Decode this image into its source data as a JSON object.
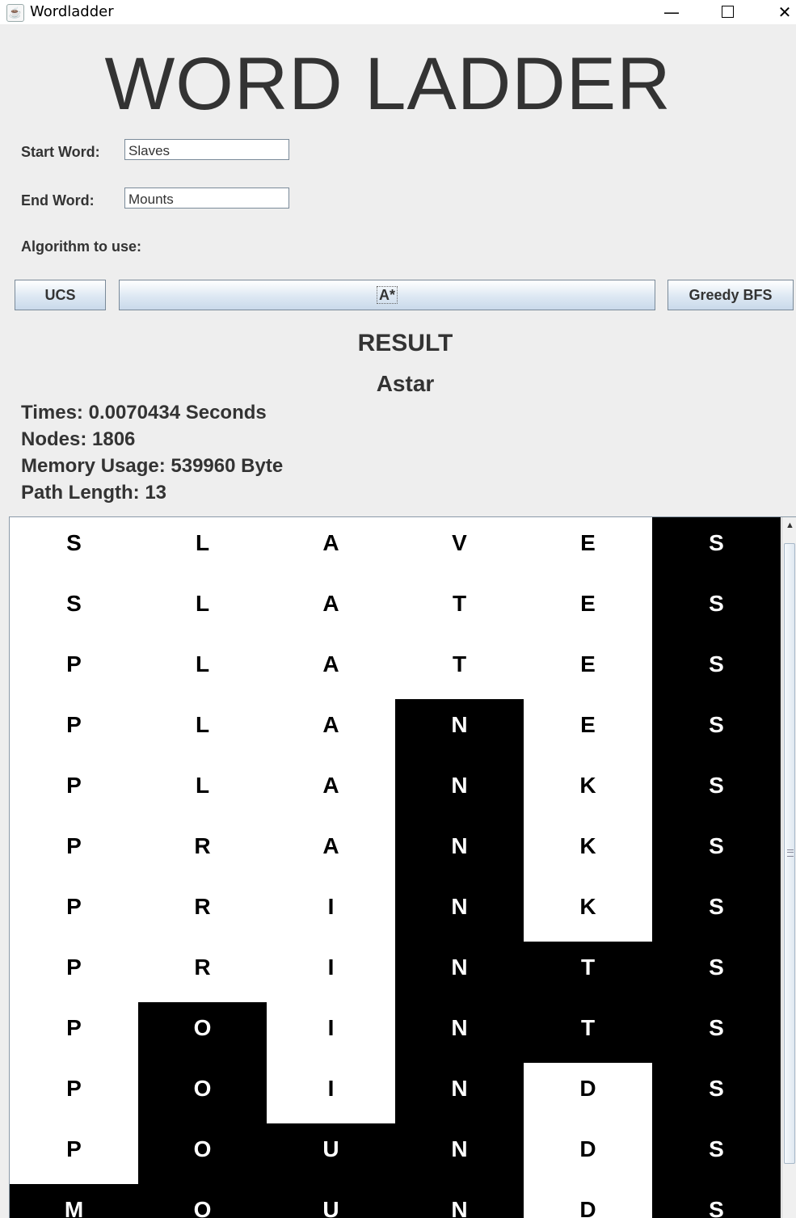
{
  "window": {
    "title": "Wordladder",
    "minimize_glyph": "—",
    "close_glyph": "✕",
    "app_icon": "java-cup-icon"
  },
  "header": {
    "title": "WORD LADDER"
  },
  "form": {
    "start_label": "Start Word:",
    "start_value": "Slaves",
    "end_label": "End Word:",
    "end_value": "Mounts",
    "algorithm_label": "Algorithm to use:"
  },
  "buttons": {
    "ucs": "UCS",
    "astar": "A*",
    "greedy": "Greedy BFS"
  },
  "result": {
    "heading": "RESULT",
    "algorithm": "Astar",
    "times": "Times: 0.0070434 Seconds",
    "nodes": "Nodes: 1806",
    "memory": "Memory Usage: 539960 Byte",
    "path_length": "Path Length: 13"
  },
  "ladder": {
    "rows": [
      {
        "letters": [
          "S",
          "L",
          "A",
          "V",
          "E",
          "S"
        ],
        "black": [
          false,
          false,
          false,
          false,
          false,
          true
        ]
      },
      {
        "letters": [
          "S",
          "L",
          "A",
          "T",
          "E",
          "S"
        ],
        "black": [
          false,
          false,
          false,
          false,
          false,
          true
        ]
      },
      {
        "letters": [
          "P",
          "L",
          "A",
          "T",
          "E",
          "S"
        ],
        "black": [
          false,
          false,
          false,
          false,
          false,
          true
        ]
      },
      {
        "letters": [
          "P",
          "L",
          "A",
          "N",
          "E",
          "S"
        ],
        "black": [
          false,
          false,
          false,
          true,
          false,
          true
        ]
      },
      {
        "letters": [
          "P",
          "L",
          "A",
          "N",
          "K",
          "S"
        ],
        "black": [
          false,
          false,
          false,
          true,
          false,
          true
        ]
      },
      {
        "letters": [
          "P",
          "R",
          "A",
          "N",
          "K",
          "S"
        ],
        "black": [
          false,
          false,
          false,
          true,
          false,
          true
        ]
      },
      {
        "letters": [
          "P",
          "R",
          "I",
          "N",
          "K",
          "S"
        ],
        "black": [
          false,
          false,
          false,
          true,
          false,
          true
        ]
      },
      {
        "letters": [
          "P",
          "R",
          "I",
          "N",
          "T",
          "S"
        ],
        "black": [
          false,
          false,
          false,
          true,
          true,
          true
        ]
      },
      {
        "letters": [
          "P",
          "O",
          "I",
          "N",
          "T",
          "S"
        ],
        "black": [
          false,
          true,
          false,
          true,
          true,
          true
        ]
      },
      {
        "letters": [
          "P",
          "O",
          "I",
          "N",
          "D",
          "S"
        ],
        "black": [
          false,
          true,
          false,
          true,
          false,
          true
        ]
      },
      {
        "letters": [
          "P",
          "O",
          "U",
          "N",
          "D",
          "S"
        ],
        "black": [
          false,
          true,
          true,
          true,
          false,
          true
        ]
      },
      {
        "letters": [
          "M",
          "O",
          "U",
          "N",
          "D",
          "S"
        ],
        "black": [
          true,
          true,
          true,
          true,
          false,
          true
        ]
      }
    ]
  }
}
